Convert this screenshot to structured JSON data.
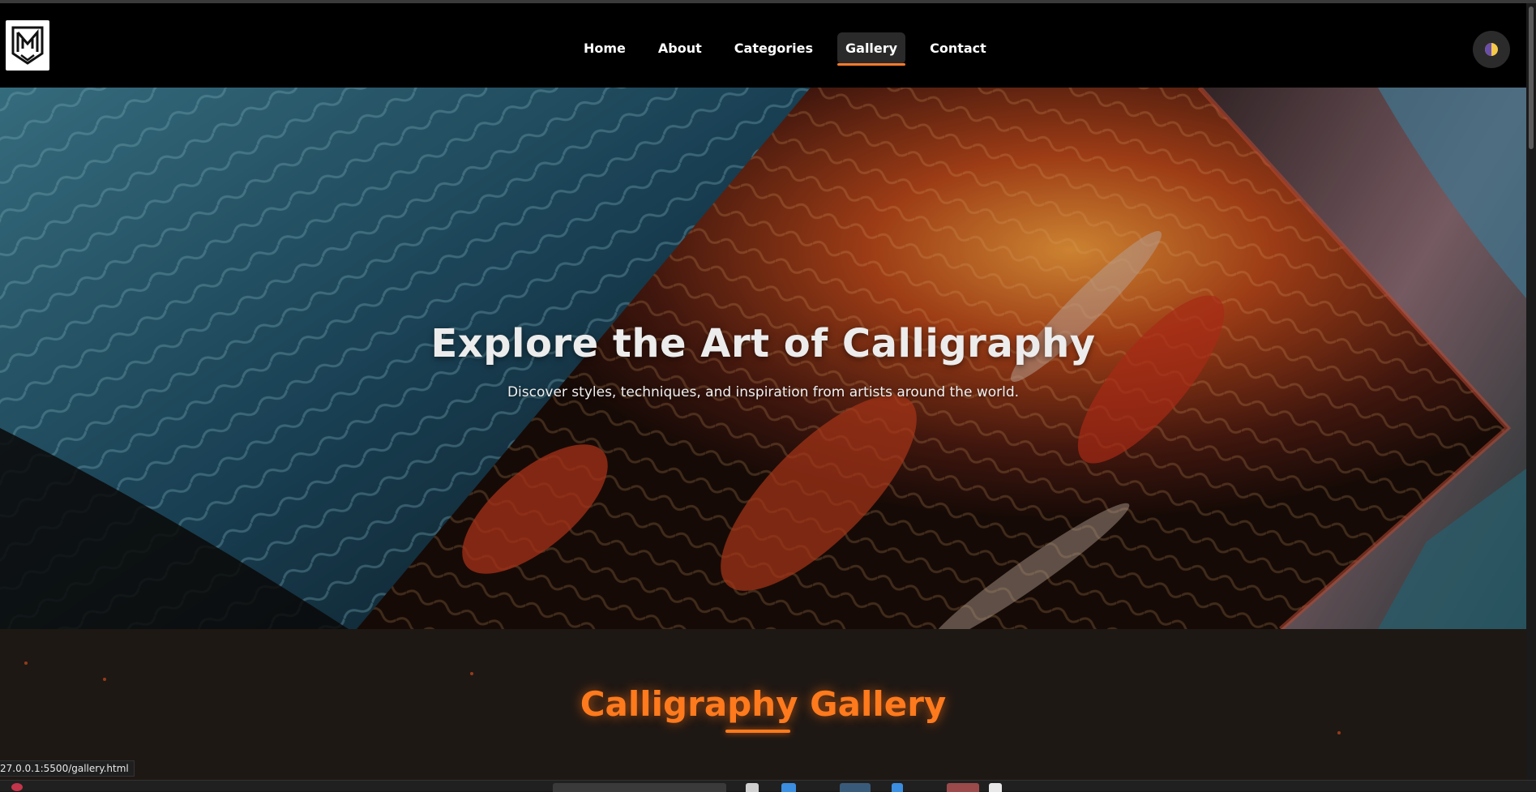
{
  "nav": {
    "logo_name": "logo-emblem",
    "links": [
      {
        "label": "Home",
        "active": false
      },
      {
        "label": "About",
        "active": false
      },
      {
        "label": "Categories",
        "active": false
      },
      {
        "label": "Gallery",
        "active": true
      },
      {
        "label": "Contact",
        "active": false
      }
    ],
    "theme_toggle_icon": "half-moon-icon"
  },
  "hero": {
    "title": "Explore the Art of Calligraphy",
    "subtitle": "Discover styles, techniques, and inspiration from artists around the world."
  },
  "gallery": {
    "title": "Calligraphy Gallery"
  },
  "status_bar": {
    "url": "27.0.0.1:5500/gallery.html"
  },
  "colors": {
    "accent": "#ff7a1c",
    "nav_bg": "#000000",
    "page_bg": "#1e1814"
  }
}
